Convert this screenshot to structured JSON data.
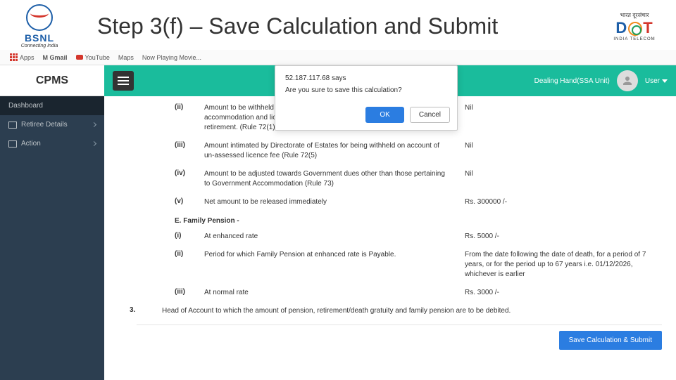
{
  "header": {
    "bsnl_text": "BSNL",
    "bsnl_tagline": "Connecting India",
    "title": "Step 3(f) – Save Calculation and Submit",
    "dot_hindi": "भारत दूरसंचार",
    "dot_sub": "INDIA TELECOM"
  },
  "bookmarks": {
    "apps": "Apps",
    "gmail": "M Gmail",
    "youtube": "YouTube",
    "maps": "Maps",
    "now": "Now Playing Movie..."
  },
  "topbar": {
    "brand": "CPMS",
    "role": "Dealing Hand(SSA Unit)",
    "user_menu": "User"
  },
  "sidebar": {
    "dashboard": "Dashboard",
    "retiree": "Retiree Details",
    "action": "Action"
  },
  "rows": {
    "ii": {
      "roman": "(ii)",
      "text": "Amount to be withheld as indicated by Directorate of Estates for Govt. accommodation and licence fee for retention of Govt. accommodation beyond retirement. (Rule 72(1) and 72(4)",
      "val": "Nil"
    },
    "iii": {
      "roman": "(iii)",
      "text": "Amount intimated by Directorate of Estates for being withheld on account of un-assessed licence fee (Rule 72(5)",
      "val": "Nil"
    },
    "iv": {
      "roman": "(iv)",
      "text": "Amount to be adjusted towards Government dues other than those pertaining to Government Accommodation (Rule 73)",
      "val": "Nil"
    },
    "v": {
      "roman": "(v)",
      "text": "Net amount to be released immediately",
      "val": "Rs. 300000 /-"
    }
  },
  "section_e": "E. Family Pension -",
  "fp": {
    "i": {
      "roman": "(i)",
      "text": "At enhanced rate",
      "val": "Rs. 5000 /-"
    },
    "ii": {
      "roman": "(ii)",
      "text": "Period for which Family Pension at enhanced rate is Payable.",
      "val": "From the date following the date of death, for a period of 7 years, or for the period up to 67 years i.e. 01/12/2026, whichever is earlier"
    },
    "iii": {
      "roman": "(iii)",
      "text": "At normal rate",
      "val": "Rs. 3000 /-"
    }
  },
  "item3": {
    "num": "3.",
    "text": "Head of Account to which the amount of pension, retirement/death gratuity and family pension are to be debited."
  },
  "submit_btn": "Save Calculation & Submit",
  "dialog": {
    "host": "52.187.117.68 says",
    "msg": "Are you sure to save this calculation?",
    "ok": "OK",
    "cancel": "Cancel"
  }
}
